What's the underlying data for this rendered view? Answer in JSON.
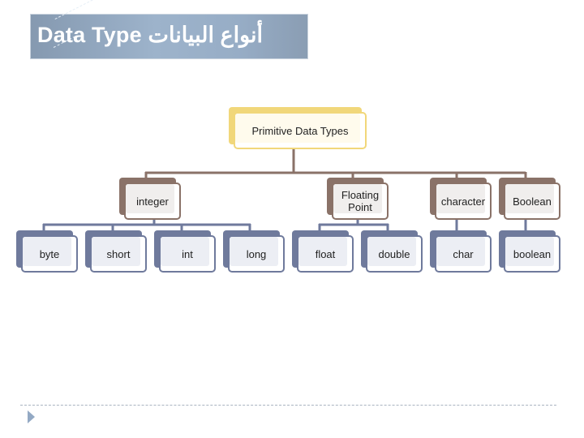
{
  "banner": {
    "title": "Data Type أنواع البيانات"
  },
  "diagram": {
    "root": {
      "label": "Primitive Data Types"
    },
    "categories": [
      {
        "label": "integer",
        "children": [
          "byte",
          "short",
          "int",
          "long"
        ]
      },
      {
        "label": "Floating Point",
        "children": [
          "float",
          "double"
        ]
      },
      {
        "label": "character",
        "children": [
          "char"
        ]
      },
      {
        "label": "Boolean",
        "children": [
          "boolean"
        ]
      }
    ],
    "types": [
      "byte",
      "short",
      "int",
      "long",
      "float",
      "double",
      "char",
      "boolean"
    ],
    "colors": {
      "root": "#f1d77a",
      "category": "#8a7268",
      "type": "#6f7a9c",
      "banner": "#97adc6"
    }
  },
  "footer": {
    "bullet_icon": "arrow-right-icon"
  }
}
